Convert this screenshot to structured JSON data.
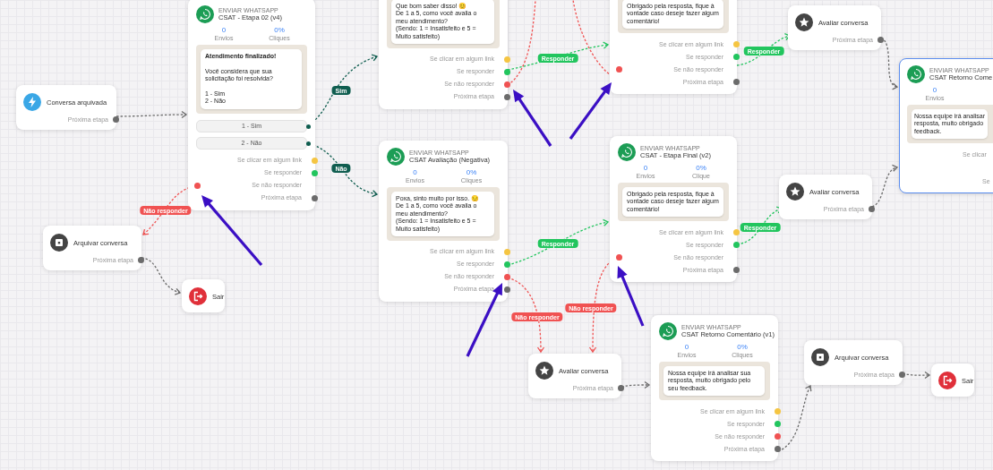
{
  "canvas": {
    "nodes": [
      {
        "kind": "trigger",
        "name": "Conversa arquivada",
        "next": "Próxima etapa",
        "selected": false
      },
      {
        "kind": "whatsapp",
        "tag": "ENVIAR WHATSAPP",
        "title": "CSAT - Etapa 02 (v4)",
        "stats": [
          {
            "value": "0",
            "label": "Envios"
          },
          {
            "value": "0%",
            "label": "Cliques"
          }
        ],
        "message": "**Atendimento finalizado!**\n\nVocê considera que sua solicitação foi resolvida?\n\n1 - Sim\n2 - Não",
        "options": [
          "1 - Sim",
          "2 - Não"
        ],
        "outputs": [
          {
            "label": "Se clicar em algum link",
            "color": "#f5c542"
          },
          {
            "label": "Se responder",
            "color": "#22c55e"
          },
          {
            "label": "Se não responder",
            "color": "#f05252"
          },
          {
            "label": "Próxima etapa",
            "color": "#6b6b6b"
          }
        ],
        "selected": false
      },
      {
        "kind": "whatsapp",
        "message": "Que bom saber disso! 😊\nDe 1 a 5, como você avalia o meu atendimento?\n(Sendo: 1 = Insatisfeito e 5 = Muito satisfeito)",
        "outputs": [
          {
            "label": "Se clicar em algum link",
            "color": "#f5c542"
          },
          {
            "label": "Se responder",
            "color": "#22c55e"
          },
          {
            "label": "Se não responder",
            "color": "#f05252"
          },
          {
            "label": "Próxima etapa",
            "color": "#6b6b6b"
          }
        ],
        "selected": false
      },
      {
        "kind": "whatsapp",
        "tag": "ENVIAR WHATSAPP",
        "title": "CSAT Avaliação (Negativa)",
        "stats": [
          {
            "value": "0",
            "label": "Envios"
          },
          {
            "value": "0%",
            "label": "Cliques"
          }
        ],
        "message": "Poxa, sinto muito por isso. 😔\nDe 1 a 5, como você avalia o meu atendimento?\n(Sendo: 1 = Insatisfeito e 5 = Muito satisfeito)",
        "outputs": [
          {
            "label": "Se clicar em algum link",
            "color": "#f5c542"
          },
          {
            "label": "Se responder",
            "color": "#22c55e"
          },
          {
            "label": "Se não responder",
            "color": "#f05252"
          },
          {
            "label": "Próxima etapa",
            "color": "#6b6b6b"
          }
        ],
        "selected": false
      },
      {
        "kind": "whatsapp",
        "message": "Obrigado pela resposta, fique à vontade caso deseje fazer algum comentário!",
        "outputs": [
          {
            "label": "Se clicar em algum link",
            "color": "#f5c542"
          },
          {
            "label": "Se responder",
            "color": "#22c55e"
          },
          {
            "label": "Se não responder",
            "color": "#f05252"
          },
          {
            "label": "Próxima etapa",
            "color": "#6b6b6b"
          }
        ],
        "selected": false
      },
      {
        "kind": "whatsapp",
        "tag": "ENVIAR WHATSAPP",
        "title": "CSAT - Etapa Final (v2)",
        "stats": [
          {
            "value": "0",
            "label": "Envios"
          },
          {
            "value": "0%",
            "label": "Clique"
          }
        ],
        "message": "Obrigado pela resposta, fique à vontade caso deseje fazer algum comentário!",
        "outputs": [
          {
            "label": "Se clicar em algum link",
            "color": "#f5c542"
          },
          {
            "label": "Se responder",
            "color": "#22c55e"
          },
          {
            "label": "Se não responder",
            "color": "#f05252"
          },
          {
            "label": "Próxima etapa",
            "color": "#6b6b6b"
          }
        ],
        "selected": false
      },
      {
        "kind": "rate",
        "name": "Avaliar conversa",
        "next": "Próxima etapa",
        "selected": false
      },
      {
        "kind": "rate",
        "name": "Avaliar conversa",
        "next": "Próxima etapa",
        "selected": false
      },
      {
        "kind": "whatsapp",
        "tag": "ENVIAR WHATSAPP",
        "title": "CSAT Retorno Come",
        "stats": [
          {
            "value": "0",
            "label": "Envios"
          }
        ],
        "message": "Nossa equipe irá analisar\nresposta, muito obrigado\nfeedback.",
        "outputs": [
          {
            "label": "Se clicar"
          },
          {
            "label": "Se"
          }
        ],
        "selected": true
      },
      {
        "kind": "rate",
        "name": "Avaliar conversa",
        "next": "Próxima etapa",
        "selected": false
      },
      {
        "kind": "whatsapp",
        "tag": "ENVIAR WHATSAPP",
        "title": "CSAT Retorno Comentário (v1)",
        "stats": [
          {
            "value": "0",
            "label": "Envios"
          },
          {
            "value": "0%",
            "label": "Cliques"
          }
        ],
        "message": "Nossa equipe irá analisar sua resposta, muito obrigado pelo seu feedback.",
        "outputs": [
          {
            "label": "Se clicar em algum link",
            "color": "#f5c542"
          },
          {
            "label": "Se responder",
            "color": "#22c55e"
          },
          {
            "label": "Se não responder",
            "color": "#f05252"
          },
          {
            "label": "Próxima etapa",
            "color": "#6b6b6b"
          }
        ],
        "selected": false
      },
      {
        "kind": "archive",
        "name": "Arquivar conversa",
        "next": "Próxima etapa",
        "selected": false
      },
      {
        "kind": "exit",
        "name": "Sair",
        "selected": false
      },
      {
        "kind": "archive",
        "name": "Arquivar conversa",
        "next": "Próxima etapa",
        "selected": false
      },
      {
        "kind": "exit",
        "name": "Sair",
        "selected": false
      }
    ],
    "edges": [
      {
        "kind": "next"
      },
      {
        "kind": "option",
        "label": "Sim"
      },
      {
        "kind": "option",
        "label": "Não"
      },
      {
        "kind": "no_reply",
        "label": "Não responder"
      },
      {
        "kind": "next"
      },
      {
        "kind": "reply",
        "label": "Responder"
      },
      {
        "kind": "no_reply"
      },
      {
        "kind": "no_reply"
      },
      {
        "kind": "reply",
        "label": "Responder"
      },
      {
        "kind": "no_reply",
        "label": "Não responder"
      },
      {
        "kind": "no_reply",
        "label": "Não responder"
      },
      {
        "kind": "reply",
        "label": "Responder"
      },
      {
        "kind": "reply",
        "label": "Responder"
      },
      {
        "kind": "next"
      },
      {
        "kind": "next"
      },
      {
        "kind": "next"
      },
      {
        "kind": "next"
      },
      {
        "kind": "next"
      }
    ]
  }
}
